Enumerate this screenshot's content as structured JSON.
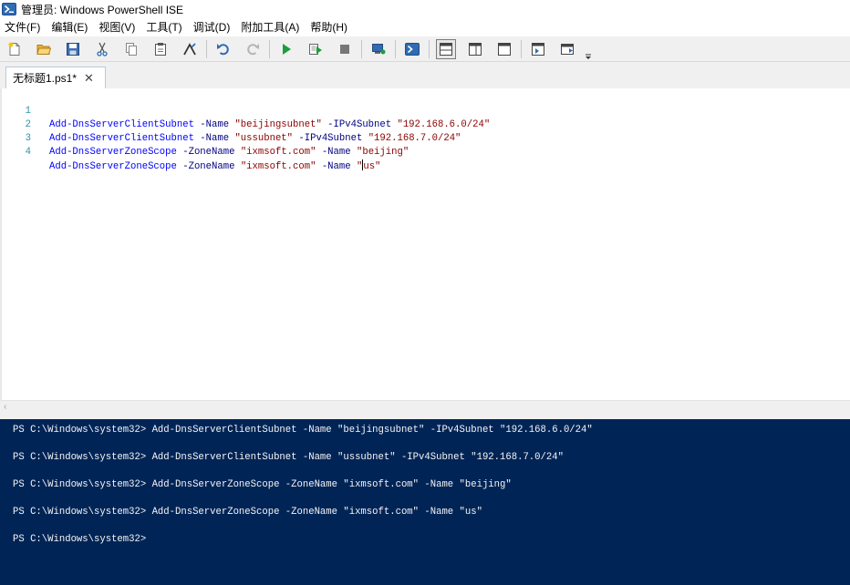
{
  "window": {
    "title": "管理员: Windows PowerShell ISE"
  },
  "menu": [
    {
      "label": "文件(F)"
    },
    {
      "label": "编辑(E)"
    },
    {
      "label": "视图(V)"
    },
    {
      "label": "工具(T)"
    },
    {
      "label": "调试(D)"
    },
    {
      "label": "附加工具(A)"
    },
    {
      "label": "帮助(H)"
    }
  ],
  "toolbar": {
    "buttons": [
      {
        "icon": "new-file-icon"
      },
      {
        "icon": "open-folder-icon"
      },
      {
        "icon": "save-icon"
      },
      {
        "icon": "cut-icon"
      },
      {
        "icon": "copy-icon"
      },
      {
        "icon": "paste-icon"
      },
      {
        "icon": "clear-console-icon"
      },
      {
        "icon": "undo-icon"
      },
      {
        "icon": "redo-icon"
      },
      {
        "icon": "run-script-icon"
      },
      {
        "icon": "run-selection-icon"
      },
      {
        "icon": "stop-icon"
      },
      {
        "icon": "remote-powershell-icon"
      },
      {
        "icon": "start-powershell-icon"
      },
      {
        "icon": "layout-script-top-icon"
      },
      {
        "icon": "layout-script-right-icon"
      },
      {
        "icon": "layout-script-maximized-icon"
      },
      {
        "icon": "show-command-window-icon"
      },
      {
        "icon": "show-command-addon-icon"
      }
    ]
  },
  "tab": {
    "label": "无标题1.ps1*",
    "close": "✕"
  },
  "editor": {
    "lines": [
      {
        "num": "1",
        "cmd": "Add-DnsServerClientSubnet",
        "p1": "-Name",
        "v1": "\"beijingsubnet\"",
        "p2": "-IPv4Subnet",
        "v2": "\"192.168.6.0/24\""
      },
      {
        "num": "2",
        "cmd": "Add-DnsServerClientSubnet",
        "p1": "-Name",
        "v1": "\"ussubnet\"",
        "p2": "-IPv4Subnet",
        "v2": "\"192.168.7.0/24\""
      },
      {
        "num": "3",
        "cmd": "Add-DnsServerZoneScope",
        "p1": "-ZoneName",
        "v1": "\"ixmsoft.com\"",
        "p2": "-Name",
        "v2": "\"beijing\""
      },
      {
        "num": "4",
        "cmd": "Add-DnsServerZoneScope",
        "p1": "-ZoneName",
        "v1": "\"ixmsoft.com\"",
        "p2": "-Name",
        "v2a": "\"",
        "v2b": "us\""
      }
    ]
  },
  "console": {
    "lines": [
      "PS C:\\Windows\\system32> Add-DnsServerClientSubnet -Name \"beijingsubnet\" -IPv4Subnet \"192.168.6.0/24\"",
      "PS C:\\Windows\\system32> Add-DnsServerClientSubnet -Name \"ussubnet\" -IPv4Subnet \"192.168.7.0/24\"",
      "PS C:\\Windows\\system32> Add-DnsServerZoneScope -ZoneName \"ixmsoft.com\" -Name \"beijing\"",
      "PS C:\\Windows\\system32> Add-DnsServerZoneScope -ZoneName \"ixmsoft.com\" -Name \"us\"",
      "PS C:\\Windows\\system32>"
    ]
  },
  "colors": {
    "console_bg": "#012456",
    "line_number": "#2b91af",
    "command": "#0000ff",
    "parameter": "#000080",
    "string": "#8b0000"
  }
}
